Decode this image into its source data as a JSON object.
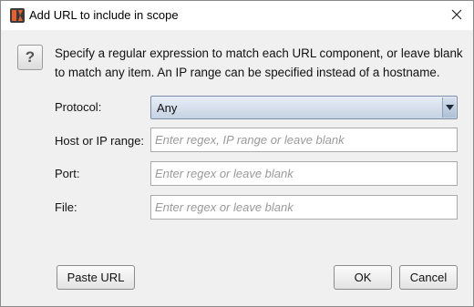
{
  "window": {
    "title": "Add URL to include in scope",
    "app_icon": "burp-suite-logo",
    "close_icon": "close-icon"
  },
  "message": {
    "icon": "question-icon",
    "icon_glyph": "?",
    "text": "Specify a regular expression to match each URL component, or leave blank to match any item. An IP range can be specified instead of a hostname."
  },
  "form": {
    "protocol": {
      "label": "Protocol:",
      "value": "Any"
    },
    "host": {
      "label": "Host or IP range:",
      "value": "",
      "placeholder": "Enter regex, IP range or leave blank"
    },
    "port": {
      "label": "Port:",
      "value": "",
      "placeholder": "Enter regex or leave blank"
    },
    "file": {
      "label": "File:",
      "value": "",
      "placeholder": "Enter regex or leave blank"
    }
  },
  "buttons": {
    "paste_url": "Paste URL",
    "ok": "OK",
    "cancel": "Cancel"
  },
  "colors": {
    "app_icon_orange": "#e8602c",
    "app_icon_dark": "#3a3a3a",
    "dialog_background": "#f0f0f0",
    "dropdown_gradient_top": "#e8eef6",
    "dropdown_gradient_bottom": "#c6d3e3"
  }
}
